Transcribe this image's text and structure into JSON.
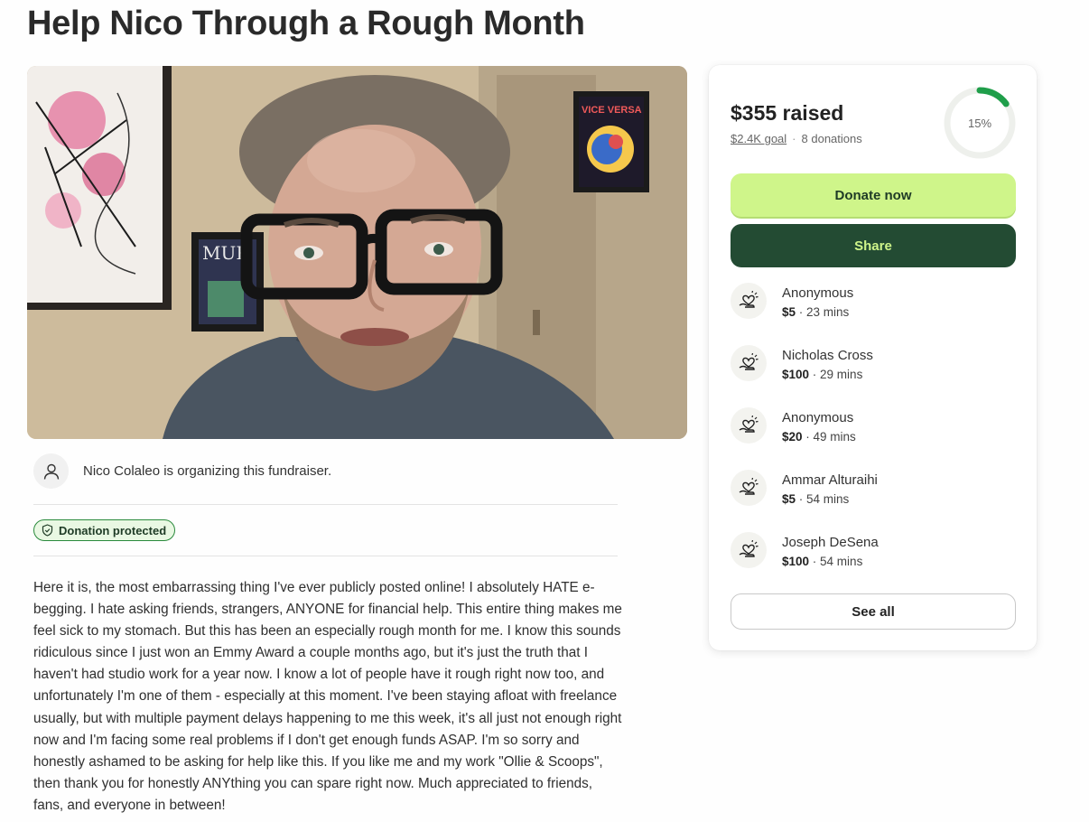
{
  "page": {
    "title": "Help Nico Through a Rough Month"
  },
  "hero": {
    "poster_text": "VICE VERSA",
    "magazine_text": "MUR"
  },
  "organizer": {
    "text": "Nico Colaleo is organizing this fundraiser."
  },
  "badge": {
    "label": "Donation protected"
  },
  "story": {
    "text": "Here it is, the most embarrassing thing I've ever publicly posted online! I absolutely HATE e-begging. I hate asking friends, strangers, ANYONE for financial help. This entire thing makes me feel sick to my stomach. But this has been an especially rough month for me. I know this sounds ridiculous since I just won an Emmy Award a couple months ago, but it's just the truth that I haven't had studio work for a year now. I know a lot of people have it rough right now too, and unfortunately I'm one of them - especially at this moment. I've been staying afloat with freelance usually, but with multiple payment delays happening to me this week, it's all just not enough right now and I'm facing some real problems if I don't get enough funds ASAP. I'm so sorry and honestly ashamed to be asking for help like this. If you like me and my work \"Ollie & Scoops\", then thank you for honestly ANYthing you can spare right now. Much appreciated to friends, fans, and everyone in between!"
  },
  "sidebar": {
    "raised": "$355 raised",
    "goal": "$2.4K goal",
    "separator": "·",
    "donation_count": "8 donations",
    "progress_label": "15%",
    "progress_fraction": 0.15,
    "donate_label": "Donate now",
    "share_label": "Share",
    "see_all_label": "See all",
    "donations": [
      {
        "name": "Anonymous",
        "amount": "$5",
        "time": " · 23 mins"
      },
      {
        "name": "Nicholas Cross",
        "amount": "$100",
        "time": " · 29 mins"
      },
      {
        "name": "Anonymous",
        "amount": "$20",
        "time": " · 49 mins"
      },
      {
        "name": "Ammar Alturaihi",
        "amount": "$5",
        "time": " · 54 mins"
      },
      {
        "name": "Joseph DeSena",
        "amount": "$100",
        "time": " · 54 mins"
      }
    ]
  },
  "colors": {
    "accent_green": "#cff58a",
    "dark_green": "#234b33",
    "ring_green": "#1f9e4a",
    "badge_border": "#2a8a3c"
  },
  "icons": {
    "organizer": "user-icon",
    "badge": "shield-check-icon",
    "donation": "heart-hand-icon"
  }
}
